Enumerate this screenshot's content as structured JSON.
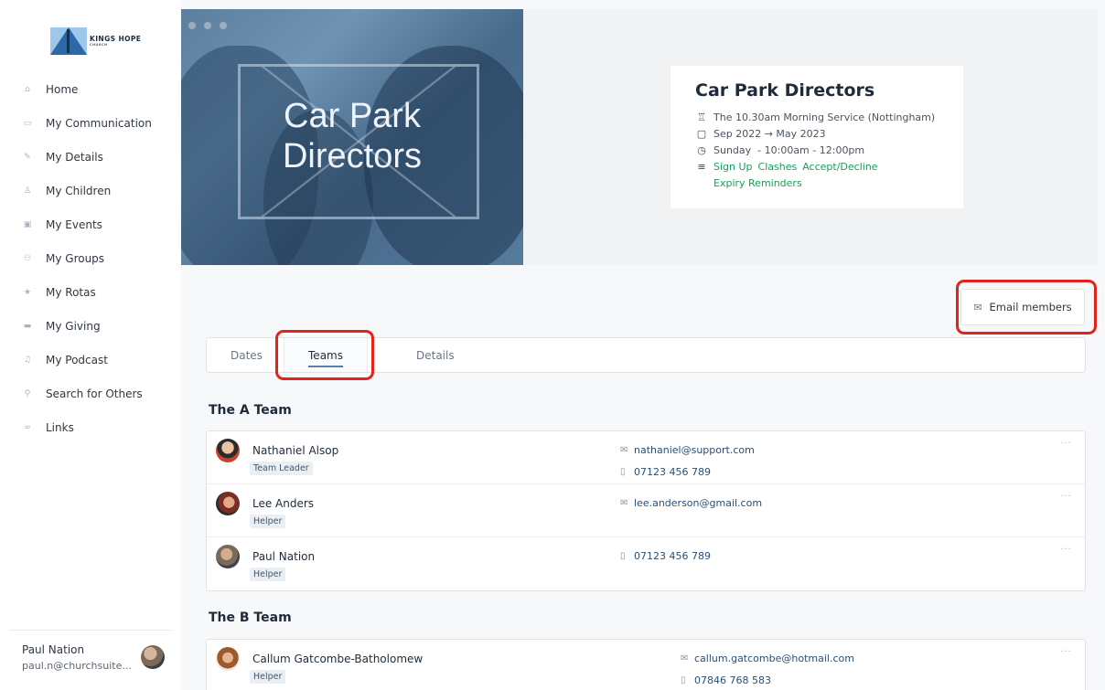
{
  "brand": {
    "name": "KINGS HOPE",
    "sub": "CHURCH"
  },
  "sidebar": {
    "items": [
      {
        "label": "Home",
        "icon": "home-icon",
        "glyph": "⌂"
      },
      {
        "label": "My Communication",
        "icon": "chat-icon",
        "glyph": "▭"
      },
      {
        "label": "My Details",
        "icon": "pencil-icon",
        "glyph": "✎"
      },
      {
        "label": "My Children",
        "icon": "child-icon",
        "glyph": "♙"
      },
      {
        "label": "My Events",
        "icon": "calendar-icon",
        "glyph": "▣"
      },
      {
        "label": "My Groups",
        "icon": "group-icon",
        "glyph": "⚇"
      },
      {
        "label": "My Rotas",
        "icon": "star-icon",
        "glyph": "★"
      },
      {
        "label": "My Giving",
        "icon": "card-icon",
        "glyph": "▬"
      },
      {
        "label": "My Podcast",
        "icon": "headphones-icon",
        "glyph": "♫"
      },
      {
        "label": "Search for Others",
        "icon": "people-search-icon",
        "glyph": "⚲"
      },
      {
        "label": "Links",
        "icon": "link-icon",
        "glyph": "∞"
      }
    ]
  },
  "user": {
    "name": "Paul Nation",
    "email": "paul.n@churchsuite..."
  },
  "hero": {
    "image_title": "Car Park Directors"
  },
  "info": {
    "title": "Car Park Directors",
    "service": "The 10.30am Morning Service (Nottingham)",
    "dates": "Sep 2022 → May 2023",
    "time": "Sunday  - 10:00am - 12:00pm",
    "links": [
      "Sign Up",
      "Clashes",
      "Accept/Decline",
      "Expiry Reminders"
    ]
  },
  "actions": {
    "email_members": "Email members"
  },
  "tabs": [
    {
      "label": "Dates"
    },
    {
      "label": "Teams"
    },
    {
      "label": "Details"
    }
  ],
  "teams": [
    {
      "name": "The A Team",
      "members": [
        {
          "name": "Nathaniel Alsop",
          "role": "Team Leader",
          "email": "nathaniel@support.com",
          "phone": "07123 456 789"
        },
        {
          "name": "Lee Anders",
          "role": "Helper",
          "email": "lee.anderson@gmail.com",
          "phone": ""
        },
        {
          "name": "Paul Nation",
          "role": "Helper",
          "email": "",
          "phone": "07123 456 789"
        }
      ]
    },
    {
      "name": "The B Team",
      "members": [
        {
          "name": "Callum Gatcombe-Batholomew",
          "role": "Helper",
          "email": "callum.gatcombe@hotmail.com",
          "phone": "07846 768 583"
        }
      ]
    }
  ],
  "colors": {
    "link_green": "#13a15a",
    "highlight_red": "#e2231a",
    "hero_blue": "#5c7f9f"
  }
}
